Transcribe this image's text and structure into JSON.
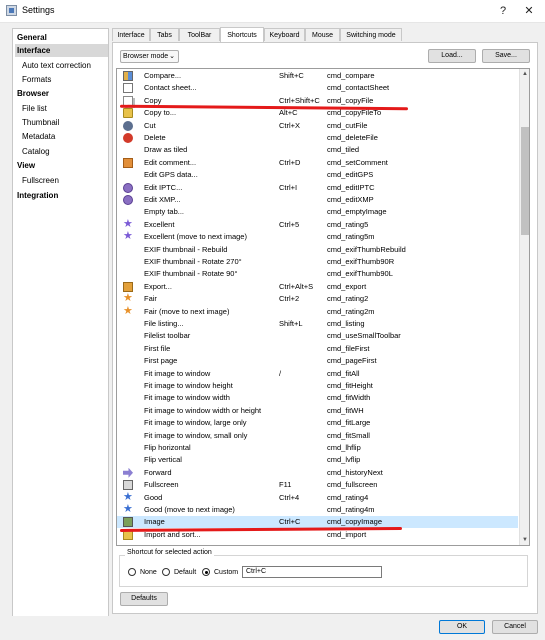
{
  "window": {
    "title": "Settings",
    "help": "?",
    "close": "✕"
  },
  "sidebar": [
    {
      "label": "General",
      "kind": "cat"
    },
    {
      "label": "Interface",
      "kind": "cat",
      "selected": true
    },
    {
      "label": "Auto text correction",
      "kind": "sub"
    },
    {
      "label": "Formats",
      "kind": "sub"
    },
    {
      "label": "Browser",
      "kind": "cat"
    },
    {
      "label": "File list",
      "kind": "sub"
    },
    {
      "label": "Thumbnail",
      "kind": "sub"
    },
    {
      "label": "Metadata",
      "kind": "sub"
    },
    {
      "label": "Catalog",
      "kind": "sub"
    },
    {
      "label": "View",
      "kind": "cat"
    },
    {
      "label": "Fullscreen",
      "kind": "sub"
    },
    {
      "label": "Integration",
      "kind": "cat"
    }
  ],
  "tabs": [
    {
      "label": "Interface"
    },
    {
      "label": "Tabs"
    },
    {
      "label": "ToolBar"
    },
    {
      "label": "Shortcuts",
      "active": true
    },
    {
      "label": "Keyboard"
    },
    {
      "label": "Mouse"
    },
    {
      "label": "Switching mode"
    }
  ],
  "toolbar": {
    "mode": "Browser mode",
    "load": "Load...",
    "save": "Save..."
  },
  "shortcuts": [
    {
      "name": "Compare...",
      "key": "Shift+C",
      "cmd": "cmd_compare",
      "icon": "compare"
    },
    {
      "name": "Contact sheet...",
      "key": "",
      "cmd": "cmd_contactSheet",
      "icon": "sheet"
    },
    {
      "name": "Copy",
      "key": "Ctrl+Shift+C",
      "cmd": "cmd_copyFile",
      "icon": "copy"
    },
    {
      "name": "Copy to...",
      "key": "Alt+C",
      "cmd": "cmd_copyFileTo",
      "icon": "folder"
    },
    {
      "name": "Cut",
      "key": "Ctrl+X",
      "cmd": "cmd_cutFile",
      "icon": "cut"
    },
    {
      "name": "Delete",
      "key": "",
      "cmd": "cmd_deleteFile",
      "icon": "delete"
    },
    {
      "name": "Draw as tiled",
      "key": "",
      "cmd": "cmd_tiled",
      "icon": ""
    },
    {
      "name": "Edit comment...",
      "key": "Ctrl+D",
      "cmd": "cmd_setComment",
      "icon": "comment"
    },
    {
      "name": "Edit GPS data...",
      "key": "",
      "cmd": "cmd_editGPS",
      "icon": ""
    },
    {
      "name": "Edit IPTC...",
      "key": "Ctrl+I",
      "cmd": "cmd_editIPTC",
      "icon": "edit"
    },
    {
      "name": "Edit XMP...",
      "key": "",
      "cmd": "cmd_editXMP",
      "icon": "edit"
    },
    {
      "name": "Empty tab...",
      "key": "",
      "cmd": "cmd_emptyImage",
      "icon": ""
    },
    {
      "name": "Excellent",
      "key": "Ctrl+5",
      "cmd": "cmd_rating5",
      "icon": "star-purple"
    },
    {
      "name": "Excellent (move to next image)",
      "key": "",
      "cmd": "cmd_rating5m",
      "icon": "star-purple"
    },
    {
      "name": "EXIF thumbnail - Rebuild",
      "key": "",
      "cmd": "cmd_exifThumbRebuild",
      "icon": ""
    },
    {
      "name": "EXIF thumbnail - Rotate 270°",
      "key": "",
      "cmd": "cmd_exifThumb90R",
      "icon": ""
    },
    {
      "name": "EXIF thumbnail - Rotate 90°",
      "key": "",
      "cmd": "cmd_exifThumb90L",
      "icon": ""
    },
    {
      "name": "Export...",
      "key": "Ctrl+Alt+S",
      "cmd": "cmd_export",
      "icon": "export"
    },
    {
      "name": "Fair",
      "key": "Ctrl+2",
      "cmd": "cmd_rating2",
      "icon": "star-orange"
    },
    {
      "name": "Fair (move to next image)",
      "key": "",
      "cmd": "cmd_rating2m",
      "icon": "star-orange"
    },
    {
      "name": "File listing...",
      "key": "Shift+L",
      "cmd": "cmd_listing",
      "icon": ""
    },
    {
      "name": "Filelist toolbar",
      "key": "",
      "cmd": "cmd_useSmallToolbar",
      "icon": ""
    },
    {
      "name": "First file",
      "key": "",
      "cmd": "cmd_fileFirst",
      "icon": ""
    },
    {
      "name": "First page",
      "key": "",
      "cmd": "cmd_pageFirst",
      "icon": ""
    },
    {
      "name": "Fit image to window",
      "key": "/",
      "cmd": "cmd_fitAll",
      "icon": ""
    },
    {
      "name": "Fit image to window height",
      "key": "",
      "cmd": "cmd_fitHeight",
      "icon": ""
    },
    {
      "name": "Fit image to window width",
      "key": "",
      "cmd": "cmd_fitWidth",
      "icon": ""
    },
    {
      "name": "Fit image to window width or height",
      "key": "",
      "cmd": "cmd_fitWH",
      "icon": ""
    },
    {
      "name": "Fit image to window, large only",
      "key": "",
      "cmd": "cmd_fitLarge",
      "icon": ""
    },
    {
      "name": "Fit image to window, small only",
      "key": "",
      "cmd": "cmd_fitSmall",
      "icon": ""
    },
    {
      "name": "Flip horizontal",
      "key": "",
      "cmd": "cmd_lhflip",
      "icon": ""
    },
    {
      "name": "Flip vertical",
      "key": "",
      "cmd": "cmd_lvflip",
      "icon": ""
    },
    {
      "name": "Forward",
      "key": "",
      "cmd": "cmd_historyNext",
      "icon": "forward"
    },
    {
      "name": "Fullscreen",
      "key": "F11",
      "cmd": "cmd_fullscreen",
      "icon": "fullscreen"
    },
    {
      "name": "Good",
      "key": "Ctrl+4",
      "cmd": "cmd_rating4",
      "icon": "star-blue"
    },
    {
      "name": "Good (move to next image)",
      "key": "",
      "cmd": "cmd_rating4m",
      "icon": "star-blue"
    },
    {
      "name": "Image",
      "key": "Ctrl+C",
      "cmd": "cmd_copyImage",
      "icon": "image",
      "selected": true
    },
    {
      "name": "Import and sort...",
      "key": "",
      "cmd": "cmd_import",
      "icon": "import"
    }
  ],
  "shortcut_group": {
    "title": "Shortcut for selected action",
    "options": [
      {
        "label": "None"
      },
      {
        "label": "Default"
      },
      {
        "label": "Custom",
        "checked": true
      }
    ],
    "value": "Ctrl+C"
  },
  "footer": {
    "defaults": "Defaults",
    "ok": "OK",
    "cancel": "Cancel"
  }
}
